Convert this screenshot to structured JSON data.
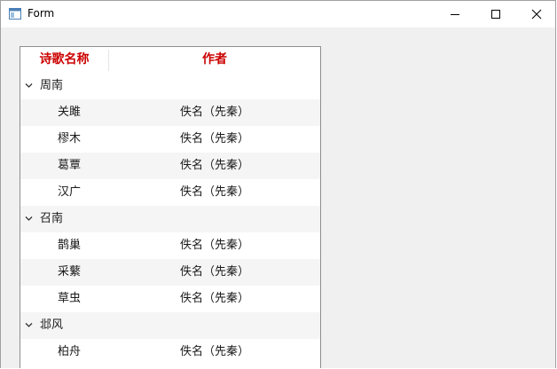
{
  "window": {
    "title": "Form",
    "controls": {
      "minimize": "minimize-icon",
      "maximize": "maximize-icon",
      "close": "close-icon"
    }
  },
  "tree": {
    "columns": [
      "诗歌名称",
      "作者"
    ],
    "header_color": "#cc0000",
    "groups": [
      {
        "name": "周南",
        "expanded": true,
        "items": [
          {
            "name": "关雎",
            "author": "佚名（先秦）"
          },
          {
            "name": "樛木",
            "author": "佚名（先秦）"
          },
          {
            "name": "葛覃",
            "author": "佚名（先秦）"
          },
          {
            "name": "汉广",
            "author": "佚名（先秦）"
          }
        ]
      },
      {
        "name": "召南",
        "expanded": true,
        "items": [
          {
            "name": "鹊巢",
            "author": "佚名（先秦）"
          },
          {
            "name": "采蘩",
            "author": "佚名（先秦）"
          },
          {
            "name": "草虫",
            "author": "佚名（先秦）"
          }
        ]
      },
      {
        "name": "邶风",
        "expanded": true,
        "items": [
          {
            "name": "柏舟",
            "author": "佚名（先秦）"
          }
        ]
      }
    ]
  }
}
